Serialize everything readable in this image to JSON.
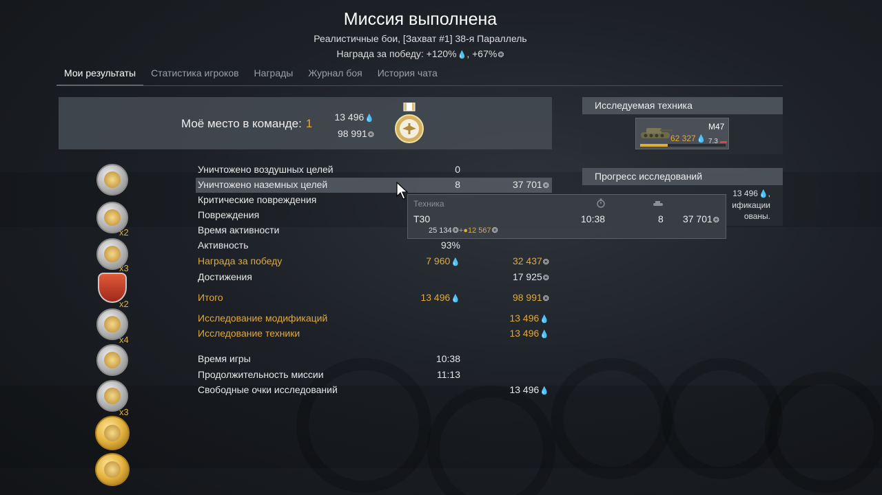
{
  "header": {
    "title": "Миссия выполнена",
    "subtitle": "Реалистичные бои, [Захват #1] 38-я Параллель",
    "reward_prefix": "Награда за победу: +120%",
    "reward_sep": ", +67%"
  },
  "tabs": [
    {
      "label": "Мои результаты",
      "active": true
    },
    {
      "label": "Статистика игроков"
    },
    {
      "label": "Награды"
    },
    {
      "label": "Журнал боя"
    },
    {
      "label": "История чата"
    }
  ],
  "place": {
    "label": "Моё место в команде:",
    "value": "1",
    "research_points": "13 496",
    "silver_lions": "98 991"
  },
  "award_multipliers": [
    "x2",
    "x3",
    "x2",
    "x4",
    "x3"
  ],
  "stats": [
    {
      "name": "Уничтожено воздушных целей",
      "a": "0",
      "b": ""
    },
    {
      "name": "Уничтожено наземных целей",
      "a": "8",
      "b": "37 701"
    },
    {
      "name": "Критические повреждения",
      "a": "",
      "b": ""
    },
    {
      "name": "Повреждения",
      "a": "",
      "b": ""
    },
    {
      "name": "Время активности",
      "a": "",
      "b": ""
    },
    {
      "name": "Активность",
      "a": "93%",
      "b": ""
    },
    {
      "name": "Награда за победу",
      "a": "7 960",
      "b": "32 437"
    },
    {
      "name": "Достижения",
      "a": "",
      "b": "17 925"
    },
    {
      "name": "Итого",
      "a": "13 496",
      "b": "98 991"
    },
    {
      "name": "Исследование модификаций",
      "a": "",
      "b": "13 496"
    },
    {
      "name": "Исследование техники",
      "a": "",
      "b": "13 496"
    },
    {
      "name": "Время игры",
      "a": "10:38",
      "b": ""
    },
    {
      "name": "Продолжительность миссии",
      "a": "11:13",
      "b": ""
    },
    {
      "name": "Свободные очки исследований",
      "a": "",
      "b": "13 496"
    }
  ],
  "tooltip": {
    "col_vehicle": "Техника",
    "vehicle": "T30",
    "time": "10:38",
    "kills": "8",
    "reward": "37 701",
    "base_reward": "25 134",
    "bonus_reward": "12 567"
  },
  "research_vehicle": {
    "header": "Исследуемая техника",
    "name": "M47",
    "points": "62 327",
    "br": "7.3"
  },
  "research_progress": {
    "header": "Прогресс исследований",
    "line1": "13 496",
    "line2": "ификации",
    "line3": "ованы."
  }
}
